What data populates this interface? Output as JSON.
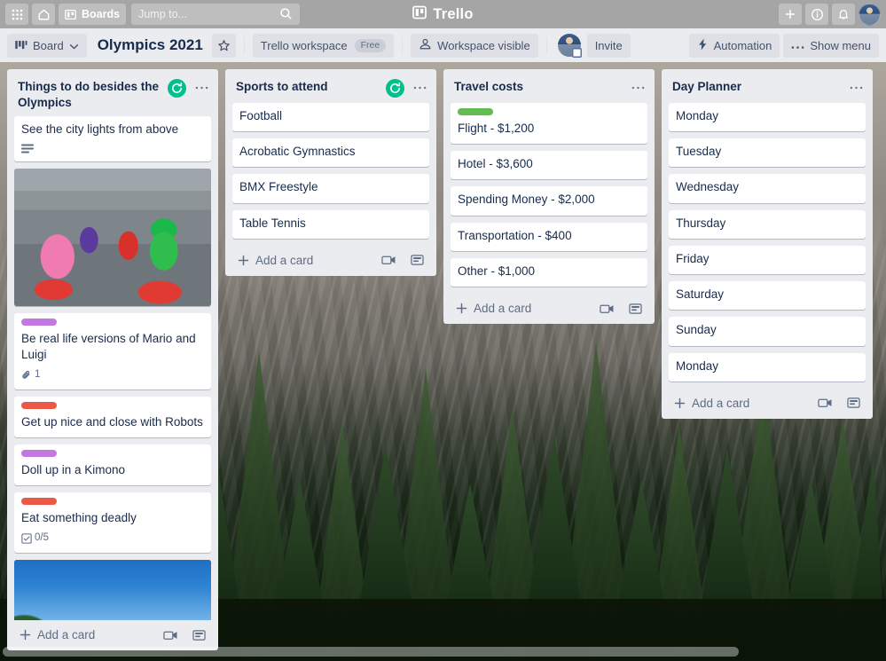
{
  "topbar": {
    "apps_icon": "grid-apps-icon",
    "home_icon": "home-icon",
    "boards_label": "Boards",
    "boards_icon": "board-icon",
    "search_placeholder": "Jump to...",
    "search_icon": "search-icon",
    "brand_name": "Trello",
    "brand_icon": "trello-logo-icon",
    "add_icon": "plus-icon",
    "info_icon": "info-circle-icon",
    "notifications_icon": "bell-icon",
    "avatar": "user-avatar"
  },
  "boardbar": {
    "view_label": "Board",
    "view_icon": "board-view-icon",
    "view_chevron": "chevron-down-icon",
    "title": "Olympics 2021",
    "star_icon": "star-icon",
    "workspace_label": "Trello workspace",
    "workspace_plan": "Free",
    "visibility_label": "Workspace visible",
    "visibility_icon": "people-icon",
    "member_avatar": "member-avatar",
    "invite_label": "Invite",
    "automation_label": "Automation",
    "automation_icon": "lightning-bolt-icon",
    "show_menu_label": "Show menu",
    "show_menu_icon": "ellipsis-icon"
  },
  "colors": {
    "label_purple": "#c377e0",
    "label_red": "#eb5a46",
    "label_green": "#61bd4f",
    "sync_green": "#00c08b",
    "list_bg": "#ebecf0",
    "text_dark": "#172b4d",
    "text_muted": "#5e6c84"
  },
  "add_card_label": "Add a card",
  "lists": [
    {
      "title": "Things to do besides the Olympics",
      "has_sync_badge": true,
      "cards": [
        {
          "type": "text",
          "title": "See the city lights from above",
          "badges": [
            {
              "icon": "description-icon",
              "text": ""
            }
          ]
        },
        {
          "type": "image",
          "cover": "mario-kart-street-photo"
        },
        {
          "type": "text",
          "label": "#c377e0",
          "title": "Be real life versions of Mario and Luigi",
          "badges": [
            {
              "icon": "attachment-icon",
              "text": "1"
            }
          ]
        },
        {
          "type": "text",
          "label": "#eb5a46",
          "title": "Get up nice and close with Robots"
        },
        {
          "type": "text",
          "label": "#c377e0",
          "title": "Doll up in a Kimono"
        },
        {
          "type": "text",
          "label": "#eb5a46",
          "title": "Eat something deadly",
          "badges": [
            {
              "icon": "checklist-icon",
              "text": "0/5"
            }
          ]
        },
        {
          "type": "image",
          "cover": "mount-fuji-photo"
        }
      ]
    },
    {
      "title": "Sports to attend",
      "has_sync_badge": true,
      "cards": [
        {
          "type": "text",
          "title": "Football"
        },
        {
          "type": "text",
          "title": "Acrobatic Gymnastics"
        },
        {
          "type": "text",
          "title": "BMX Freestyle"
        },
        {
          "type": "text",
          "title": "Table Tennis"
        }
      ]
    },
    {
      "title": "Travel costs",
      "has_sync_badge": false,
      "cards": [
        {
          "type": "text",
          "label": "#61bd4f",
          "title": "Flight - $1,200"
        },
        {
          "type": "text",
          "title": "Hotel - $3,600"
        },
        {
          "type": "text",
          "title": "Spending Money - $2,000"
        },
        {
          "type": "text",
          "title": "Transportation - $400"
        },
        {
          "type": "text",
          "title": "Other - $1,000"
        }
      ]
    },
    {
      "title": "Day Planner",
      "has_sync_badge": false,
      "cards": [
        {
          "type": "text",
          "title": "Monday"
        },
        {
          "type": "text",
          "title": "Tuesday"
        },
        {
          "type": "text",
          "title": "Wednesday"
        },
        {
          "type": "text",
          "title": "Thursday"
        },
        {
          "type": "text",
          "title": "Friday"
        },
        {
          "type": "text",
          "title": "Saturday"
        },
        {
          "type": "text",
          "title": "Sunday"
        },
        {
          "type": "text",
          "title": "Monday"
        }
      ]
    }
  ]
}
